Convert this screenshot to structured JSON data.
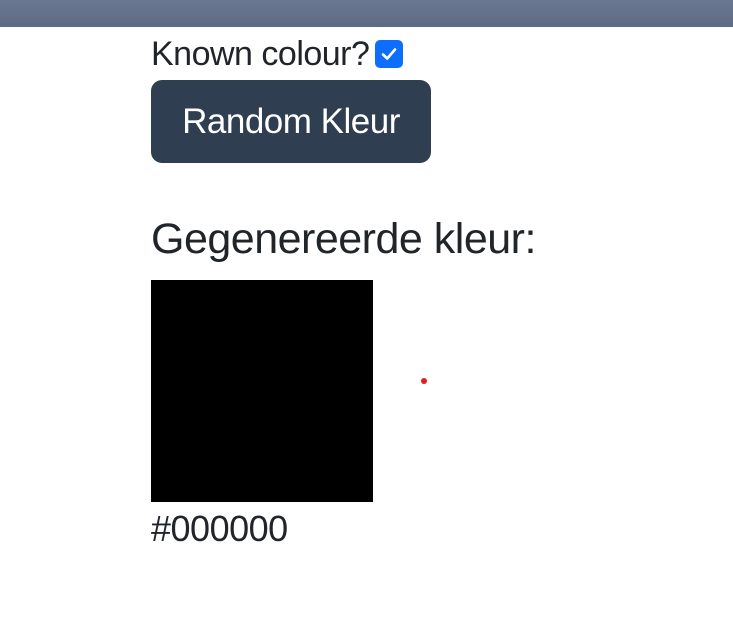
{
  "header": {
    "color": "#637089"
  },
  "form": {
    "known_label": "Known colour?",
    "known_checked": true,
    "button_label": "Random Kleur"
  },
  "result": {
    "heading": "Gegenereerde kleur:",
    "color_hex": "#000000"
  },
  "colors": {
    "accent": "#0d6efd",
    "button_bg": "#2f3e51",
    "cursor_dot": "#e02020"
  }
}
